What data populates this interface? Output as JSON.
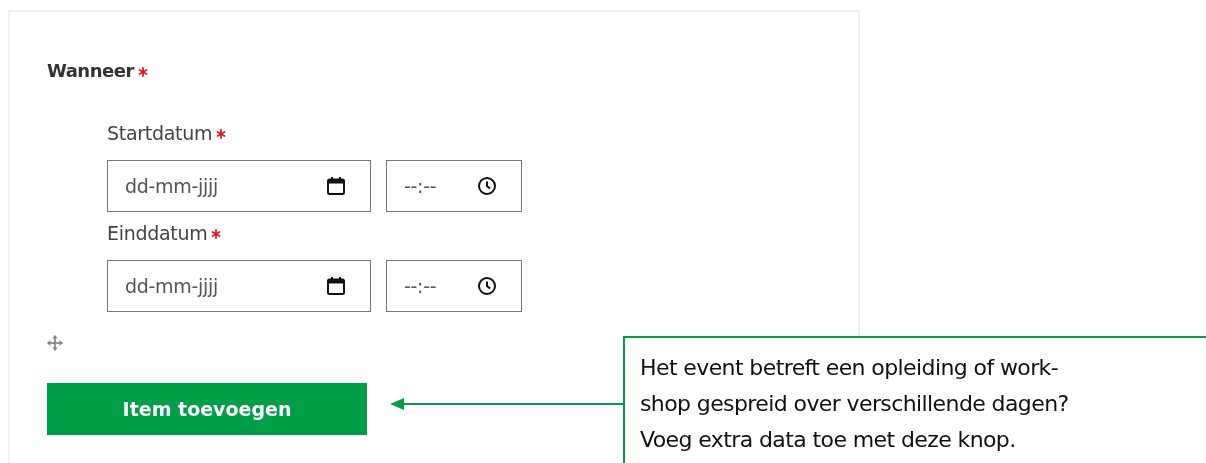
{
  "section": {
    "title": "Wanneer",
    "required": true
  },
  "date_rows": [
    {
      "label": "Startdatum",
      "required": true,
      "date": {
        "placeholder": "dd-mm-jjjj"
      },
      "time": {
        "placeholder": "--:--"
      }
    },
    {
      "label": "Einddatum",
      "required": true,
      "date": {
        "placeholder": "dd-mm-jjjj"
      },
      "time": {
        "placeholder": "--:--"
      }
    }
  ],
  "add_button": {
    "label": "Item toevoegen"
  },
  "callout": {
    "lines": [
      "Het event betreft een opleiding of work-",
      "shop gespreid over verschillende dagen?",
      "Voeg extra data toe met deze knop."
    ]
  }
}
